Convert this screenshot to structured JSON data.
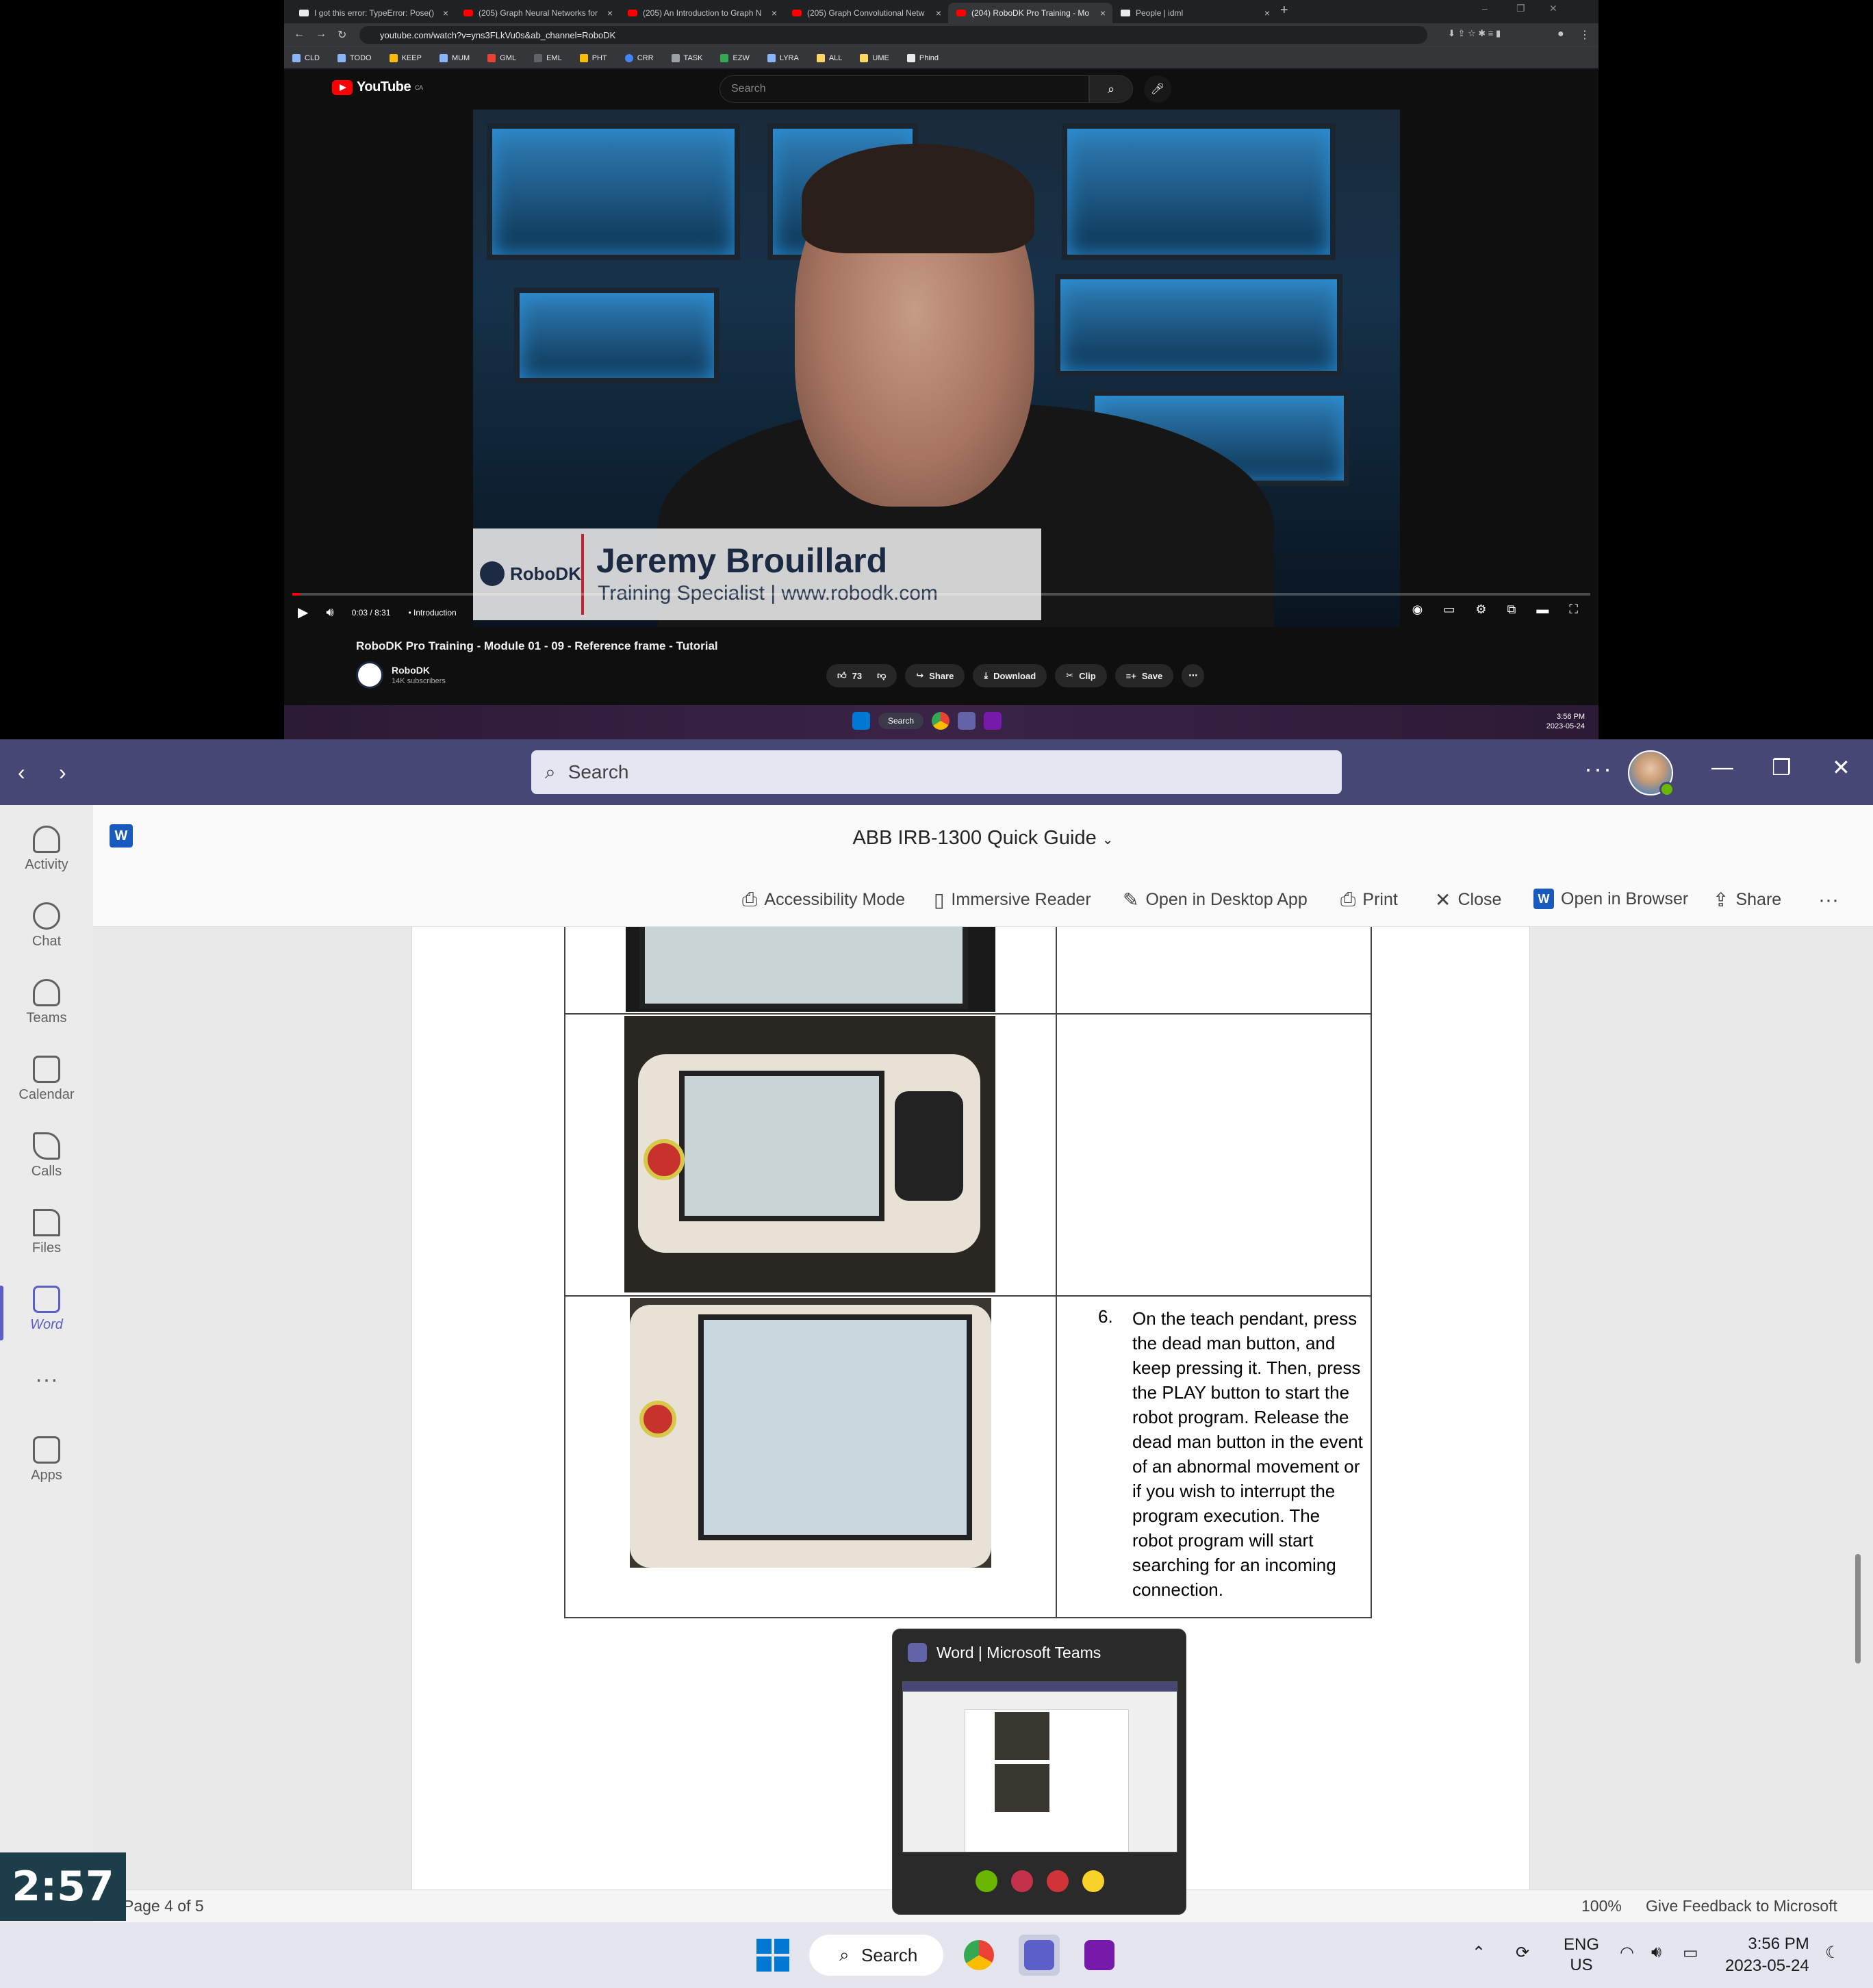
{
  "browser": {
    "tabs": [
      {
        "label": "I got this error: TypeError: Pose()"
      },
      {
        "label": "(205) Graph Neural Networks for"
      },
      {
        "label": "(205) An Introduction to Graph N"
      },
      {
        "label": "(205) Graph Convolutional Netw"
      },
      {
        "label": "(204) RoboDK Pro Training - Mo"
      },
      {
        "label": "People | idml"
      }
    ],
    "url": "youtube.com/watch?v=yns3FLkVu0s&ab_channel=RoboDK",
    "bookmarks": [
      "CLD",
      "TODO",
      "KEEP",
      "MUM",
      "GML",
      "EML",
      "PHT",
      "CRR",
      "TASK",
      "EZW",
      "LYRA",
      "ALL",
      "UME",
      "Phind"
    ]
  },
  "youtube": {
    "logo": "YouTube",
    "logo_region": "CA",
    "search_placeholder": "Search",
    "lower_third_brand": "RoboDK",
    "lower_third_name": "Jeremy Brouillard",
    "lower_third_role": "Training Specialist | www.robodk.com",
    "time": "0:03 / 8:31",
    "chapter": "• Introduction",
    "progress_fraction": 0.006,
    "video_title": "RoboDK Pro Training - Module 01 - 09 - Reference frame - Tutorial",
    "channel_name": "RoboDK",
    "channel_subs": "14K subscribers",
    "likes": "73",
    "share": "Share",
    "download": "Download",
    "clip": "Clip",
    "save": "Save",
    "mini_taskbar_search": "Search",
    "mini_time": "3:56 PM",
    "mini_date": "2023-05-24"
  },
  "teams": {
    "search_placeholder": "Search",
    "rail": [
      "Activity",
      "Chat",
      "Teams",
      "Calendar",
      "Calls",
      "Files",
      "Word",
      "Apps"
    ],
    "doc_title": "ABB IRB-1300 Quick Guide",
    "toolbar": {
      "accessibility": "Accessibility Mode",
      "immersive": "Immersive Reader",
      "desktop": "Open in Desktop App",
      "print": "Print",
      "close": "Close",
      "browser": "Open in Browser",
      "share": "Share"
    },
    "step_number": "6.",
    "step_text": "On the teach pendant, press the dead man button, and keep pressing it. Then, press the PLAY button to start the robot program. Release the dead man button in the event of an abnormal movement or if you wish to interrupt the program execution. The robot program will start searching for an incoming connection.",
    "page_status": "Page 4 of 5",
    "zoom": "100%",
    "feedback": "Give Feedback to Microsoft",
    "preview_title": "Word | Microsoft Teams"
  },
  "overlay_timer": "2:57",
  "taskbar": {
    "search": "Search",
    "lang": "ENG",
    "region": "US",
    "time": "3:56 PM",
    "date": "2023-05-24"
  }
}
